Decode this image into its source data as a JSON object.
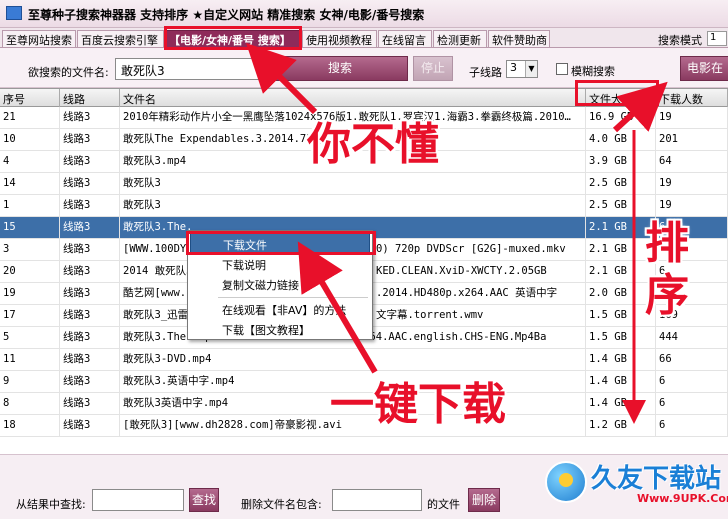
{
  "window": {
    "title": "至尊种子搜索神器器 支持排序 ★自定义网站 精准搜索   女神/电影/番号搜索"
  },
  "tabs": [
    {
      "label": "至尊网站搜索"
    },
    {
      "label": "百度云搜索引擎"
    },
    {
      "label": "【电影/女神/番号 搜索】"
    },
    {
      "label": "使用视频教程"
    },
    {
      "label": "在线留言"
    },
    {
      "label": "检测更新"
    },
    {
      "label": "软件赞助商"
    }
  ],
  "search_mode": {
    "label": "搜索模式",
    "value": "1"
  },
  "search": {
    "label": "欲搜索的文件名:",
    "value": "敢死队3",
    "search_button": "搜索",
    "stop_button": "停止",
    "route_label": "子线路",
    "route_value": "3",
    "fuzzy_label": "模糊搜索",
    "movie_button": "电影在"
  },
  "table": {
    "headers": {
      "num": "序号",
      "route": "线路",
      "name": "文件名",
      "size": "文件大小",
      "downloads": "下载人数"
    },
    "rows": [
      {
        "num": "21",
        "route": "线路3",
        "name": "2010年精彩动作片小全一黑鹰坠落1024x576版1.敢死队1.罗宾汉1.海霸3.拳霸终极篇.2010…",
        "size": "16.9 GB",
        "downloads": "19"
      },
      {
        "num": "10",
        "route": "线路3",
        "name": "敢死队The Expendables.3.2014.720p.",
        "size": "4.0 GB",
        "downloads": "201"
      },
      {
        "num": "4",
        "route": "线路3",
        "name": "敢死队3.mp4",
        "size": "3.9 GB",
        "downloads": "64"
      },
      {
        "num": "14",
        "route": "线路3",
        "name": "敢死队3",
        "size": "2.5 GB",
        "downloads": "19"
      },
      {
        "num": "1",
        "route": "线路3",
        "name": "敢死队3",
        "size": "2.5 GB",
        "downloads": "19"
      },
      {
        "num": "15",
        "route": "线路3",
        "name": "敢死队3.The.",
        "size": "2.1 GB",
        "downloads": "6"
      },
      {
        "num": "3",
        "route": "线路3",
        "name": "[WWW.100DYS.",
        "name_tail": "0) 720p DVDScr [G2G]-muxed.mkv",
        "size": "2.1 GB",
        "downloads": "6"
      },
      {
        "num": "20",
        "route": "线路3",
        "name": "2014 敢死队3",
        "name_tail": "KED.CLEAN.XviD-XWCTY.2.05GB",
        "size": "2.1 GB",
        "downloads": "6"
      },
      {
        "num": "19",
        "route": "线路3",
        "name": "酷艺网[www.k",
        "name_tail": ".2014.HD480p.x264.AAC 英语中字",
        "size": "2.0 GB",
        "downloads": "19"
      },
      {
        "num": "17",
        "route": "线路3",
        "name": "敢死队3_迅雷",
        "name_tail": "文字幕.torrent.wmv",
        "size": "1.5 GB",
        "downloads": "169"
      },
      {
        "num": "5",
        "route": "线路3",
        "name": "敢死队3.The.Expendables.3.2014.DVDScr.X264.AAC.english.CHS-ENG.Mp4Ba",
        "size": "1.5 GB",
        "downloads": "444"
      },
      {
        "num": "11",
        "route": "线路3",
        "name": "敢死队3-DVD.mp4",
        "size": "1.4 GB",
        "downloads": "66"
      },
      {
        "num": "9",
        "route": "线路3",
        "name": "敢死队3.英语中字.mp4",
        "size": "1.4 GB",
        "downloads": "6"
      },
      {
        "num": "8",
        "route": "线路3",
        "name": "敢死队3英语中字.mp4",
        "size": "1.4 GB",
        "downloads": "6"
      },
      {
        "num": "18",
        "route": "线路3",
        "name": "[敢死队3][www.dh2828.com]帝豪影视.avi",
        "size": "1.2 GB",
        "downloads": "6"
      }
    ]
  },
  "context_menu": {
    "items": [
      "下载文件",
      "下载说明",
      "复制文磁力链接",
      "在线观看【非AV】的方法",
      "下载【图文教程】"
    ]
  },
  "bottom": {
    "find_label": "从结果中查找:",
    "find_button": "查找",
    "delete_label": "删除文件名包含:",
    "suffix_label": "的文件",
    "delete_button": "删除"
  },
  "annotations": {
    "dont_understand": "你不懂",
    "sort": "排序",
    "one_click_download": "一键下载"
  },
  "watermark": {
    "name": "久友下载站",
    "url": "Www.9UPK.Com"
  },
  "colors": {
    "accent": "#8e2b5a",
    "selection": "#3d6fa8",
    "annotation_red": "#e8102a",
    "watermark_blue": "#1a7fd6"
  }
}
